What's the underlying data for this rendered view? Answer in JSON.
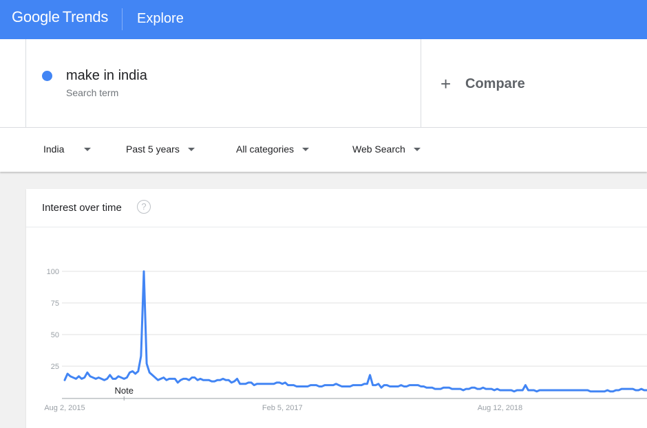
{
  "header": {
    "brand_google": "Google",
    "brand_trends": "Trends",
    "page": "Explore",
    "brand_color": "#4285f4"
  },
  "term": {
    "name": "make in india",
    "sub": "Search term",
    "dot_color": "#4285f4",
    "compare_label": "Compare",
    "compare_icon": "plus-icon"
  },
  "filters": [
    {
      "label": "India"
    },
    {
      "label": "Past 5 years"
    },
    {
      "label": "All categories"
    },
    {
      "label": "Web Search"
    }
  ],
  "card": {
    "title": "Interest over time",
    "help_icon": "help-circle-icon",
    "help_glyph": "?"
  },
  "chart_data": {
    "type": "line",
    "title": "",
    "xlabel": "",
    "ylabel": "",
    "ylim": [
      0,
      100
    ],
    "yticks": [
      25,
      50,
      75,
      100
    ],
    "grid": true,
    "x_tick_labels": [
      "Aug 2, 2015",
      "Feb 5, 2017",
      "Aug 12, 2018"
    ],
    "annotation": "Note",
    "line_color": "#4285f4",
    "series": [
      {
        "values": [
          14,
          19,
          17,
          16,
          15,
          17,
          15,
          16,
          20,
          17,
          16,
          15,
          16,
          15,
          14,
          15,
          18,
          15,
          15,
          17,
          16,
          15,
          16,
          20,
          21,
          19,
          21,
          33,
          100,
          27,
          20,
          18,
          16,
          14,
          15,
          16,
          14,
          15,
          15,
          15,
          12,
          14,
          15,
          15,
          14,
          16,
          16,
          14,
          15,
          14,
          14,
          14,
          13,
          13,
          14,
          14,
          15,
          14,
          14,
          12,
          13,
          15,
          11,
          11,
          11,
          12,
          12,
          10,
          11,
          11,
          11,
          11,
          11,
          11,
          11,
          12,
          12,
          11,
          12,
          10,
          10,
          10,
          9,
          9,
          9,
          9,
          9,
          10,
          10,
          10,
          9,
          9,
          10,
          10,
          10,
          10,
          11,
          10,
          9,
          9,
          9,
          9,
          10,
          10,
          10,
          10,
          11,
          11,
          18,
          10,
          10,
          11,
          8,
          10,
          10,
          9,
          9,
          9,
          9,
          10,
          9,
          9,
          10,
          10,
          10,
          10,
          9,
          9,
          8,
          8,
          8,
          7,
          7,
          7,
          8,
          8,
          8,
          7,
          7,
          7,
          7,
          6,
          7,
          7,
          8,
          8,
          7,
          7,
          8,
          7,
          7,
          7,
          6,
          7,
          6,
          6,
          6,
          6,
          6,
          5,
          6,
          6,
          6,
          10,
          6,
          6,
          6,
          5,
          6,
          6,
          6,
          6,
          6,
          6,
          6,
          6,
          6,
          6,
          6,
          6,
          6,
          6,
          6,
          6,
          6,
          6,
          5,
          5,
          5,
          5,
          5,
          5,
          6,
          5,
          5,
          6,
          6,
          7,
          7,
          7,
          7,
          7,
          6,
          6,
          7,
          6,
          6
        ]
      }
    ]
  }
}
